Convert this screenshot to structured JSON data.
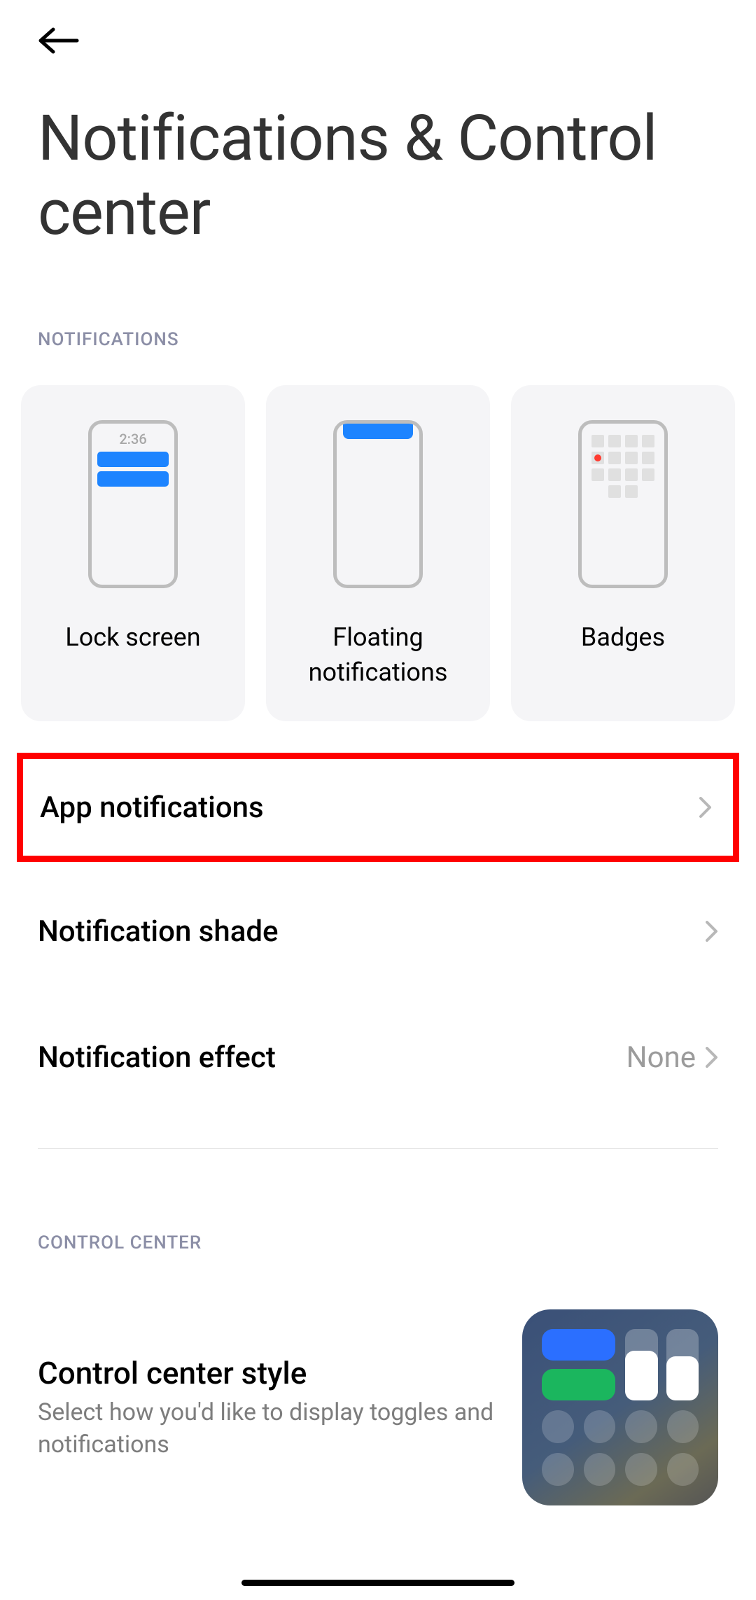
{
  "page_title": "Notifications & Control center",
  "sections": {
    "notifications_header": "Notifications",
    "control_center_header": "Control Center"
  },
  "cards": [
    {
      "label": "Lock screen",
      "mock_time": "2:36"
    },
    {
      "label": "Floating notifications"
    },
    {
      "label": "Badges"
    }
  ],
  "list": {
    "app_notifications": {
      "label": "App notifications"
    },
    "notification_shade": {
      "label": "Notification shade"
    },
    "notification_effect": {
      "label": "Notification effect",
      "value": "None"
    }
  },
  "control_center": {
    "title": "Control center style",
    "subtitle": "Select how you'd like to display toggles and notifications"
  },
  "highlight": {
    "target": "app_notifications",
    "color": "#ff0000"
  }
}
